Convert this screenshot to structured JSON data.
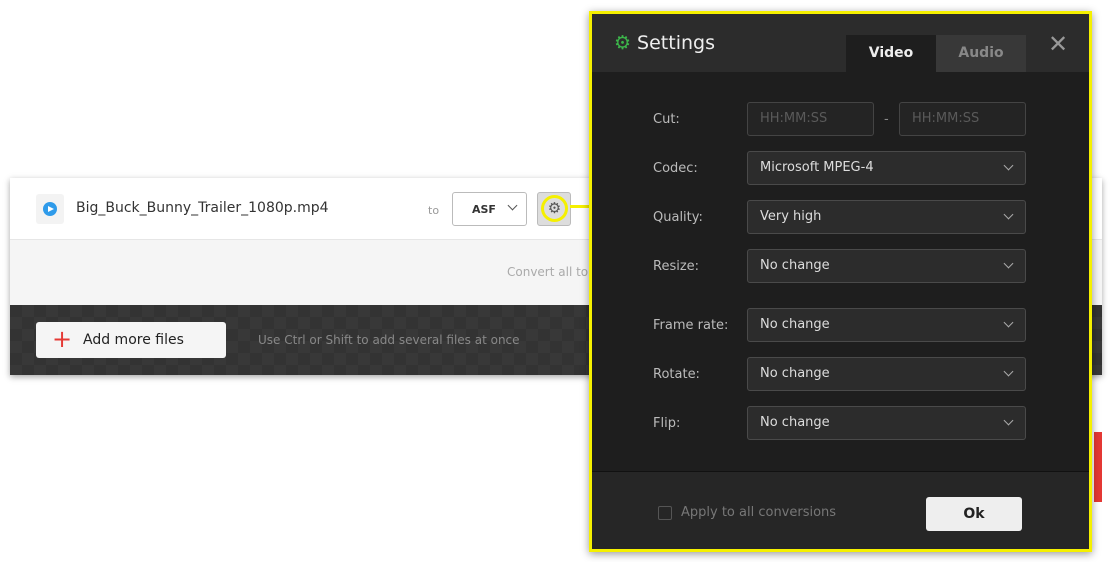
{
  "file": {
    "name": "Big_Buck_Bunny_Trailer_1080p.mp4",
    "to_label": "to",
    "format": "ASF",
    "convert_all": "Convert all to"
  },
  "bottom": {
    "add_button": "Add more files",
    "hint": "Use Ctrl or Shift to add several files at once"
  },
  "settings": {
    "title": "Settings",
    "tabs": [
      {
        "label": "Video",
        "active": true
      },
      {
        "label": "Audio",
        "active": false
      }
    ],
    "cut": {
      "label": "Cut:",
      "start_placeholder": "HH:MM:SS",
      "end_placeholder": "HH:MM:SS",
      "separator": "-"
    },
    "codec": {
      "label": "Codec:",
      "value": "Microsoft MPEG-4"
    },
    "quality": {
      "label": "Quality:",
      "value": "Very high"
    },
    "resize": {
      "label": "Resize:",
      "value": "No change"
    },
    "frame_rate": {
      "label": "Frame rate:",
      "value": "No change"
    },
    "rotate": {
      "label": "Rotate:",
      "value": "No change"
    },
    "flip": {
      "label": "Flip:",
      "value": "No change"
    },
    "apply_all": {
      "label": "Apply to all conversions",
      "checked": false
    },
    "ok": "Ok"
  },
  "colors": {
    "accent_green": "#3cb54a",
    "highlight": "#f5f000",
    "add_red": "#e53935",
    "play_blue": "#2f9bea"
  }
}
